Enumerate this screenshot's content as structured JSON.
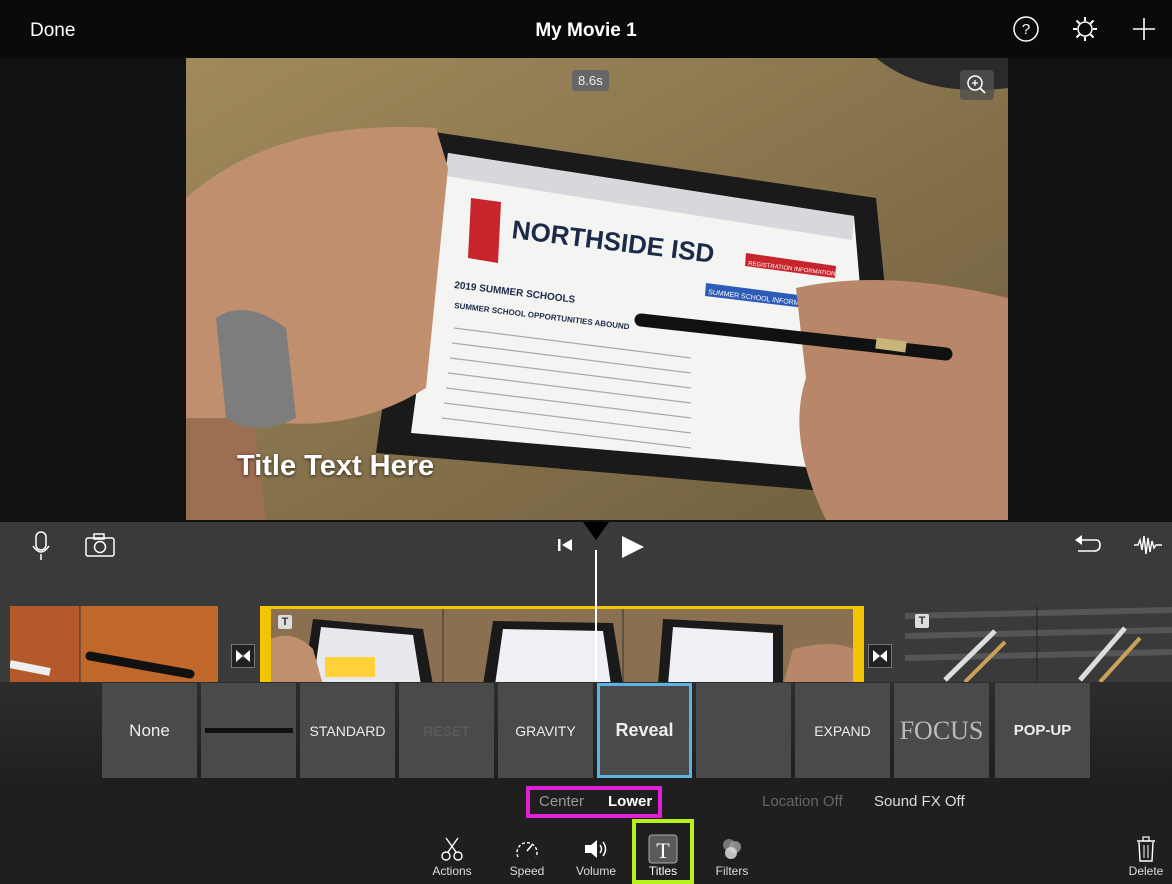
{
  "topbar": {
    "done_label": "Done",
    "title": "My Movie 1",
    "icons": [
      "help-icon",
      "settings-icon",
      "add-icon"
    ]
  },
  "viewer": {
    "duration_badge": "8.6s",
    "overlay_title": "Title Text Here",
    "zoom_icon": "zoom-in-icon",
    "video_content": {
      "site_name": "NORTHSIDE ISD",
      "page_heading": "2019 SUMMER SCHOOLS",
      "subheading": "SUMMER SCHOOL OPPORTUNITIES ABOUND",
      "side_heading": "SUMMER SCHOOL INFORMATION",
      "register_label": "REGISTRATION INFORMATION"
    }
  },
  "controls": {
    "left_icons": [
      "microphone-icon",
      "camera-icon"
    ],
    "center_icons": [
      "skip-to-start-icon",
      "play-icon"
    ],
    "right_icons": [
      "undo-icon",
      "audio-waveform-icon"
    ]
  },
  "timeline": {
    "title_badge": "T",
    "transition_icon": "transition-icon"
  },
  "title_styles": [
    {
      "label": "None"
    },
    {
      "label": ""
    },
    {
      "label": "STANDARD"
    },
    {
      "label": "RESET"
    },
    {
      "label": "GRAVITY"
    },
    {
      "label": "Reveal",
      "selected": true
    },
    {
      "label": ""
    },
    {
      "label": "EXPAND"
    },
    {
      "label": "FOCUS"
    },
    {
      "label": "POP-UP"
    }
  ],
  "position_options": {
    "center": "Center",
    "lower": "Lower",
    "selected": "Lower"
  },
  "location": "Location Off",
  "sound_fx": "Sound FX Off",
  "toolbar": [
    {
      "label": "Actions",
      "icon": "scissors-icon"
    },
    {
      "label": "Speed",
      "icon": "speedometer-icon"
    },
    {
      "label": "Volume",
      "icon": "volume-icon"
    },
    {
      "label": "Titles",
      "icon": "titles-icon",
      "active": true
    },
    {
      "label": "Filters",
      "icon": "filters-icon"
    }
  ],
  "delete_label": "Delete",
  "colors": {
    "selected_style_border": "#5ab4e6",
    "position_highlight": "#e01fd7",
    "titles_highlight": "#b6f21c",
    "clip_selection": "#f2c500"
  }
}
